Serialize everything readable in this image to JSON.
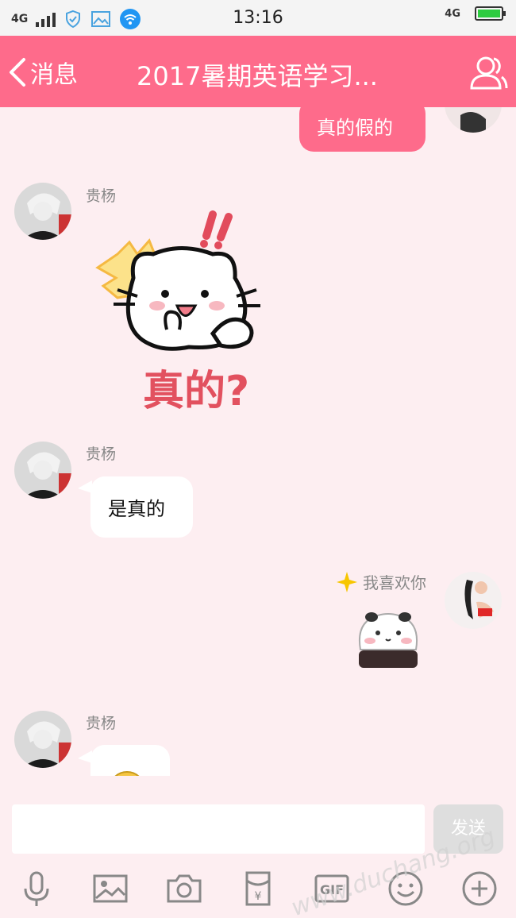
{
  "status_bar": {
    "network_left": "4G",
    "time": "13:16",
    "network_right": "4G"
  },
  "header": {
    "back_label": "消息",
    "title": "2017暑期英语学习..."
  },
  "messages": [
    {
      "side": "right",
      "type": "text",
      "text": "真的假的"
    },
    {
      "side": "left",
      "type": "sticker",
      "sender": "贵杨",
      "sticker_text": "真的?"
    },
    {
      "side": "left",
      "type": "text",
      "sender": "贵杨",
      "text": "是真的"
    },
    {
      "side": "right",
      "type": "sticker",
      "sender": "我喜欢你"
    },
    {
      "side": "left",
      "type": "emoji",
      "sender": "贵杨"
    }
  ],
  "input": {
    "placeholder": "",
    "send_label": "发送"
  },
  "toolbar": [
    "mic-icon",
    "image-icon",
    "camera-icon",
    "red-packet-icon",
    "gif-icon",
    "emoji-icon",
    "plus-icon"
  ],
  "colors": {
    "accent": "#fe6b8b",
    "background": "#fdeef1"
  },
  "watermark": "www.duchang.org"
}
